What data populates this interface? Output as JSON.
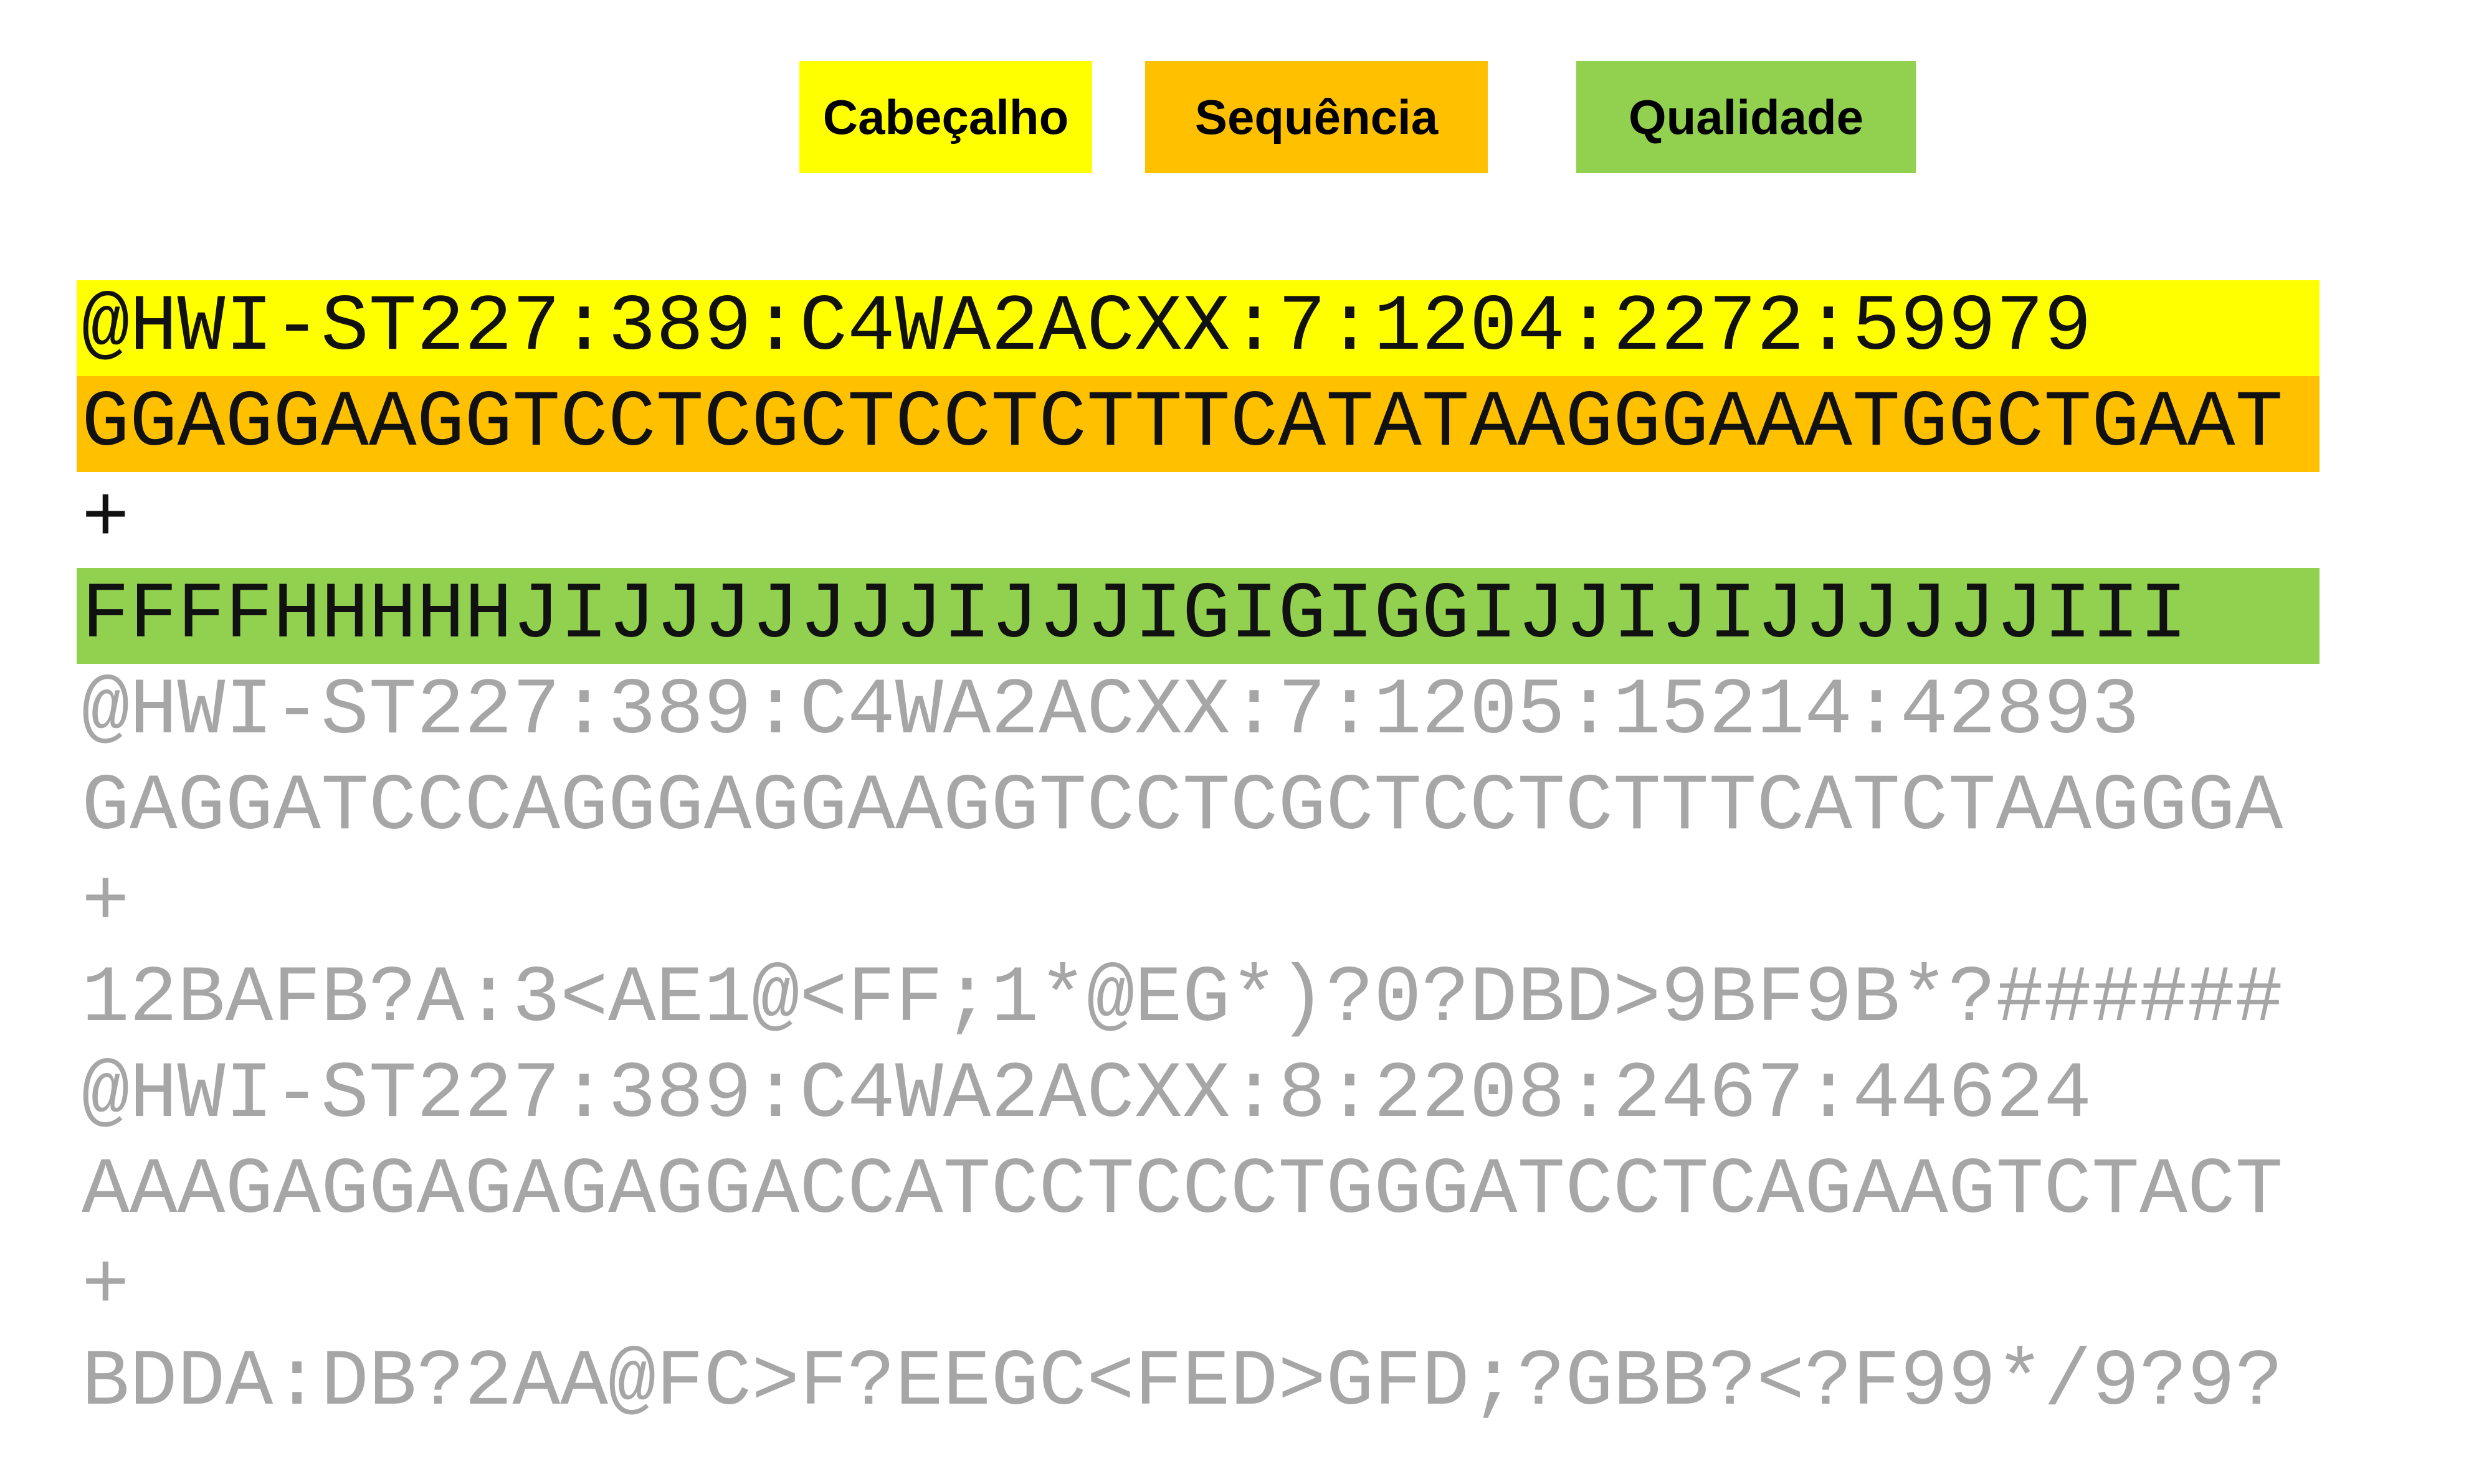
{
  "legend": {
    "header": "Cabeçalho",
    "sequence": "Sequência",
    "quality": "Qualidade"
  },
  "colors": {
    "header": "#ffff00",
    "sequence": "#ffc000",
    "quality": "#92d050",
    "faded_text": "#a6a6a6"
  },
  "records": [
    {
      "header": "@HWI-ST227:389:C4WA2ACXX:7:1204:2272:59979",
      "sequence": "GGAGGAAGGTCCTCGCTCCTCTTTCATATAAGGGAAATGGCTGAAT",
      "separator": "+",
      "quality": "FFFFHHHHHJIJJJJJJJIJJJIGIGIGGIJJIJIJJJJJJIII"
    },
    {
      "header": "@HWI-ST227:389:C4WA2ACXX:7:1205:15214:42893",
      "sequence": "GAGGATCCCAGGGAGGAAGGTCCTCGCTCCTCTTTCATCTAAGGGA",
      "separator": "+",
      "quality": "12BAFB?A:3<AE1@<FF;1*@EG*)?0?DBD>9BF9B*?######"
    },
    {
      "header": "@HWI-ST227:389:C4WA2ACXX:8:2208:2467:44624",
      "sequence": "AAAGAGGAGAGAGGACCATCCTCCCTGGGATCCTCAGAAGTCTACT",
      "separator": "+",
      "quality": "BDDA:DB?2AA@FC>F?EEGC<FED>GFD;?GBB?<?F99*/9?9?"
    }
  ]
}
